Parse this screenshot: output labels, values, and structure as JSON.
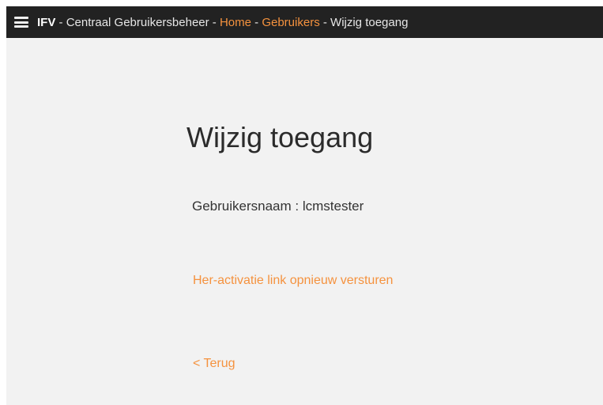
{
  "header": {
    "menu_icon": "hamburger-menu-icon",
    "brand": "IFV",
    "separator": " - ",
    "app_title": "Centraal Gebruikersbeheer",
    "breadcrumbs": [
      {
        "label": "Home",
        "link": true
      },
      {
        "label": "Gebruikers",
        "link": true
      },
      {
        "label": "Wijzig toegang",
        "link": false
      }
    ],
    "colors": {
      "bar_background": "#222222",
      "link": "#f5923e"
    }
  },
  "main": {
    "title": "Wijzig toegang",
    "username_label": "Gebruikersnaam",
    "username_separator": " : ",
    "username_value": "lcmstester",
    "reactivate_link": "Her-activatie link opnieuw versturen",
    "back_link": "< Terug"
  }
}
